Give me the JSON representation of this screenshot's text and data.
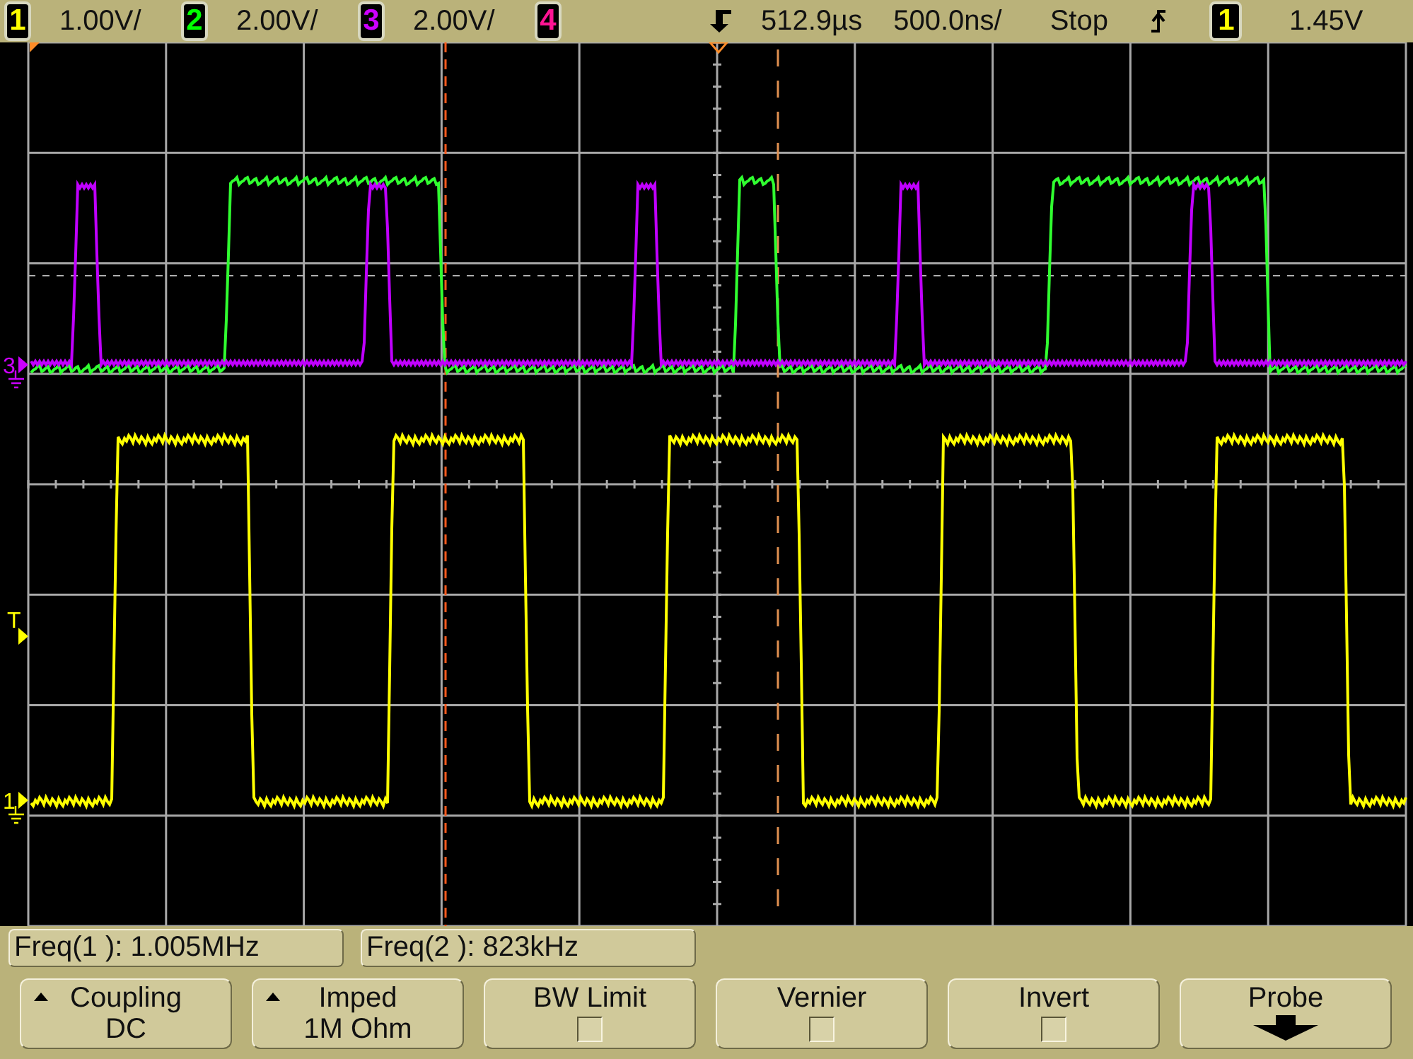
{
  "top_bar": {
    "channels": [
      {
        "number": "1",
        "scale": "1.00V/",
        "color": "#ffff00"
      },
      {
        "number": "2",
        "scale": "2.00V/",
        "color": "#00ff00"
      },
      {
        "number": "3",
        "scale": "2.00V/",
        "color": "#cc00ff"
      },
      {
        "number": "4",
        "color": "#ff1493"
      }
    ],
    "delay": "512.9µs",
    "timebase": "500.0ns/",
    "run_state": "Stop",
    "trigger_source": {
      "number": "1",
      "color": "#ffff00"
    },
    "trigger_level": "1.45V"
  },
  "display": {
    "markers": [
      {
        "label": "3",
        "color": "#cc00ff"
      },
      {
        "label": "T",
        "color": "#ffff00"
      },
      {
        "label": "1",
        "color": "#ffff00"
      }
    ]
  },
  "measurements": [
    "Freq(1 ): 1.005MHz",
    "Freq(2 ): 823kHz"
  ],
  "softkeys": [
    {
      "kind": "menu",
      "label": "Coupling",
      "value": "DC"
    },
    {
      "kind": "menu",
      "label": "Imped",
      "value": "1M Ohm"
    },
    {
      "kind": "checkbox",
      "label": "BW Limit",
      "checked": false
    },
    {
      "kind": "checkbox",
      "label": "Vernier",
      "checked": false
    },
    {
      "kind": "checkbox",
      "label": "Invert",
      "checked": false
    },
    {
      "kind": "submenu",
      "label": "Probe"
    }
  ]
}
